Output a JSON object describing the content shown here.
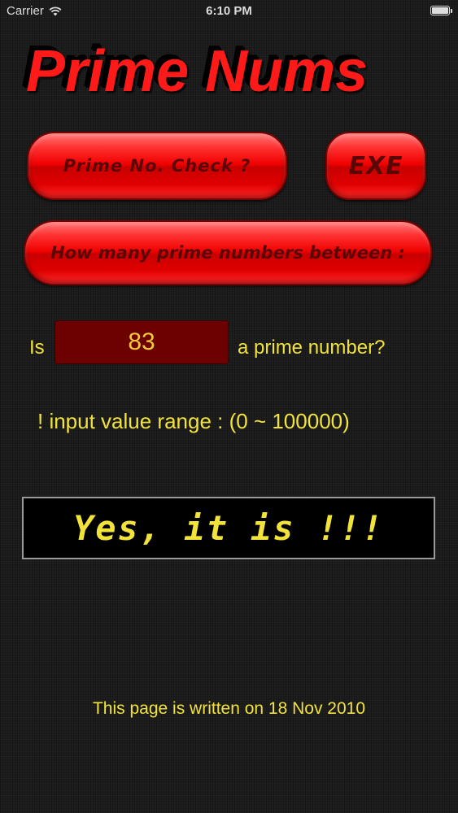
{
  "status_bar": {
    "carrier": "Carrier",
    "time": "6:10 PM",
    "wifi_icon": "wifi-icon",
    "battery_icon": "battery-icon"
  },
  "app": {
    "title": "Prime Nums"
  },
  "buttons": {
    "prime_check_label": "Prime No. Check ?",
    "exe_label": "EXE",
    "how_many_label": "How many prime numbers between :"
  },
  "question": {
    "prefix": "Is",
    "input_value": "83",
    "suffix": "a prime number?"
  },
  "range_note": "!  input value range : (0 ~ 100000)",
  "result": "Yes, it is !!!",
  "footer": "This page is written on 18 Nov 2010",
  "colors": {
    "accent_red": "#ff1a1a",
    "text_yellow": "#f2e33a",
    "field_bg": "#6d0000",
    "background": "#1c1c1c"
  }
}
